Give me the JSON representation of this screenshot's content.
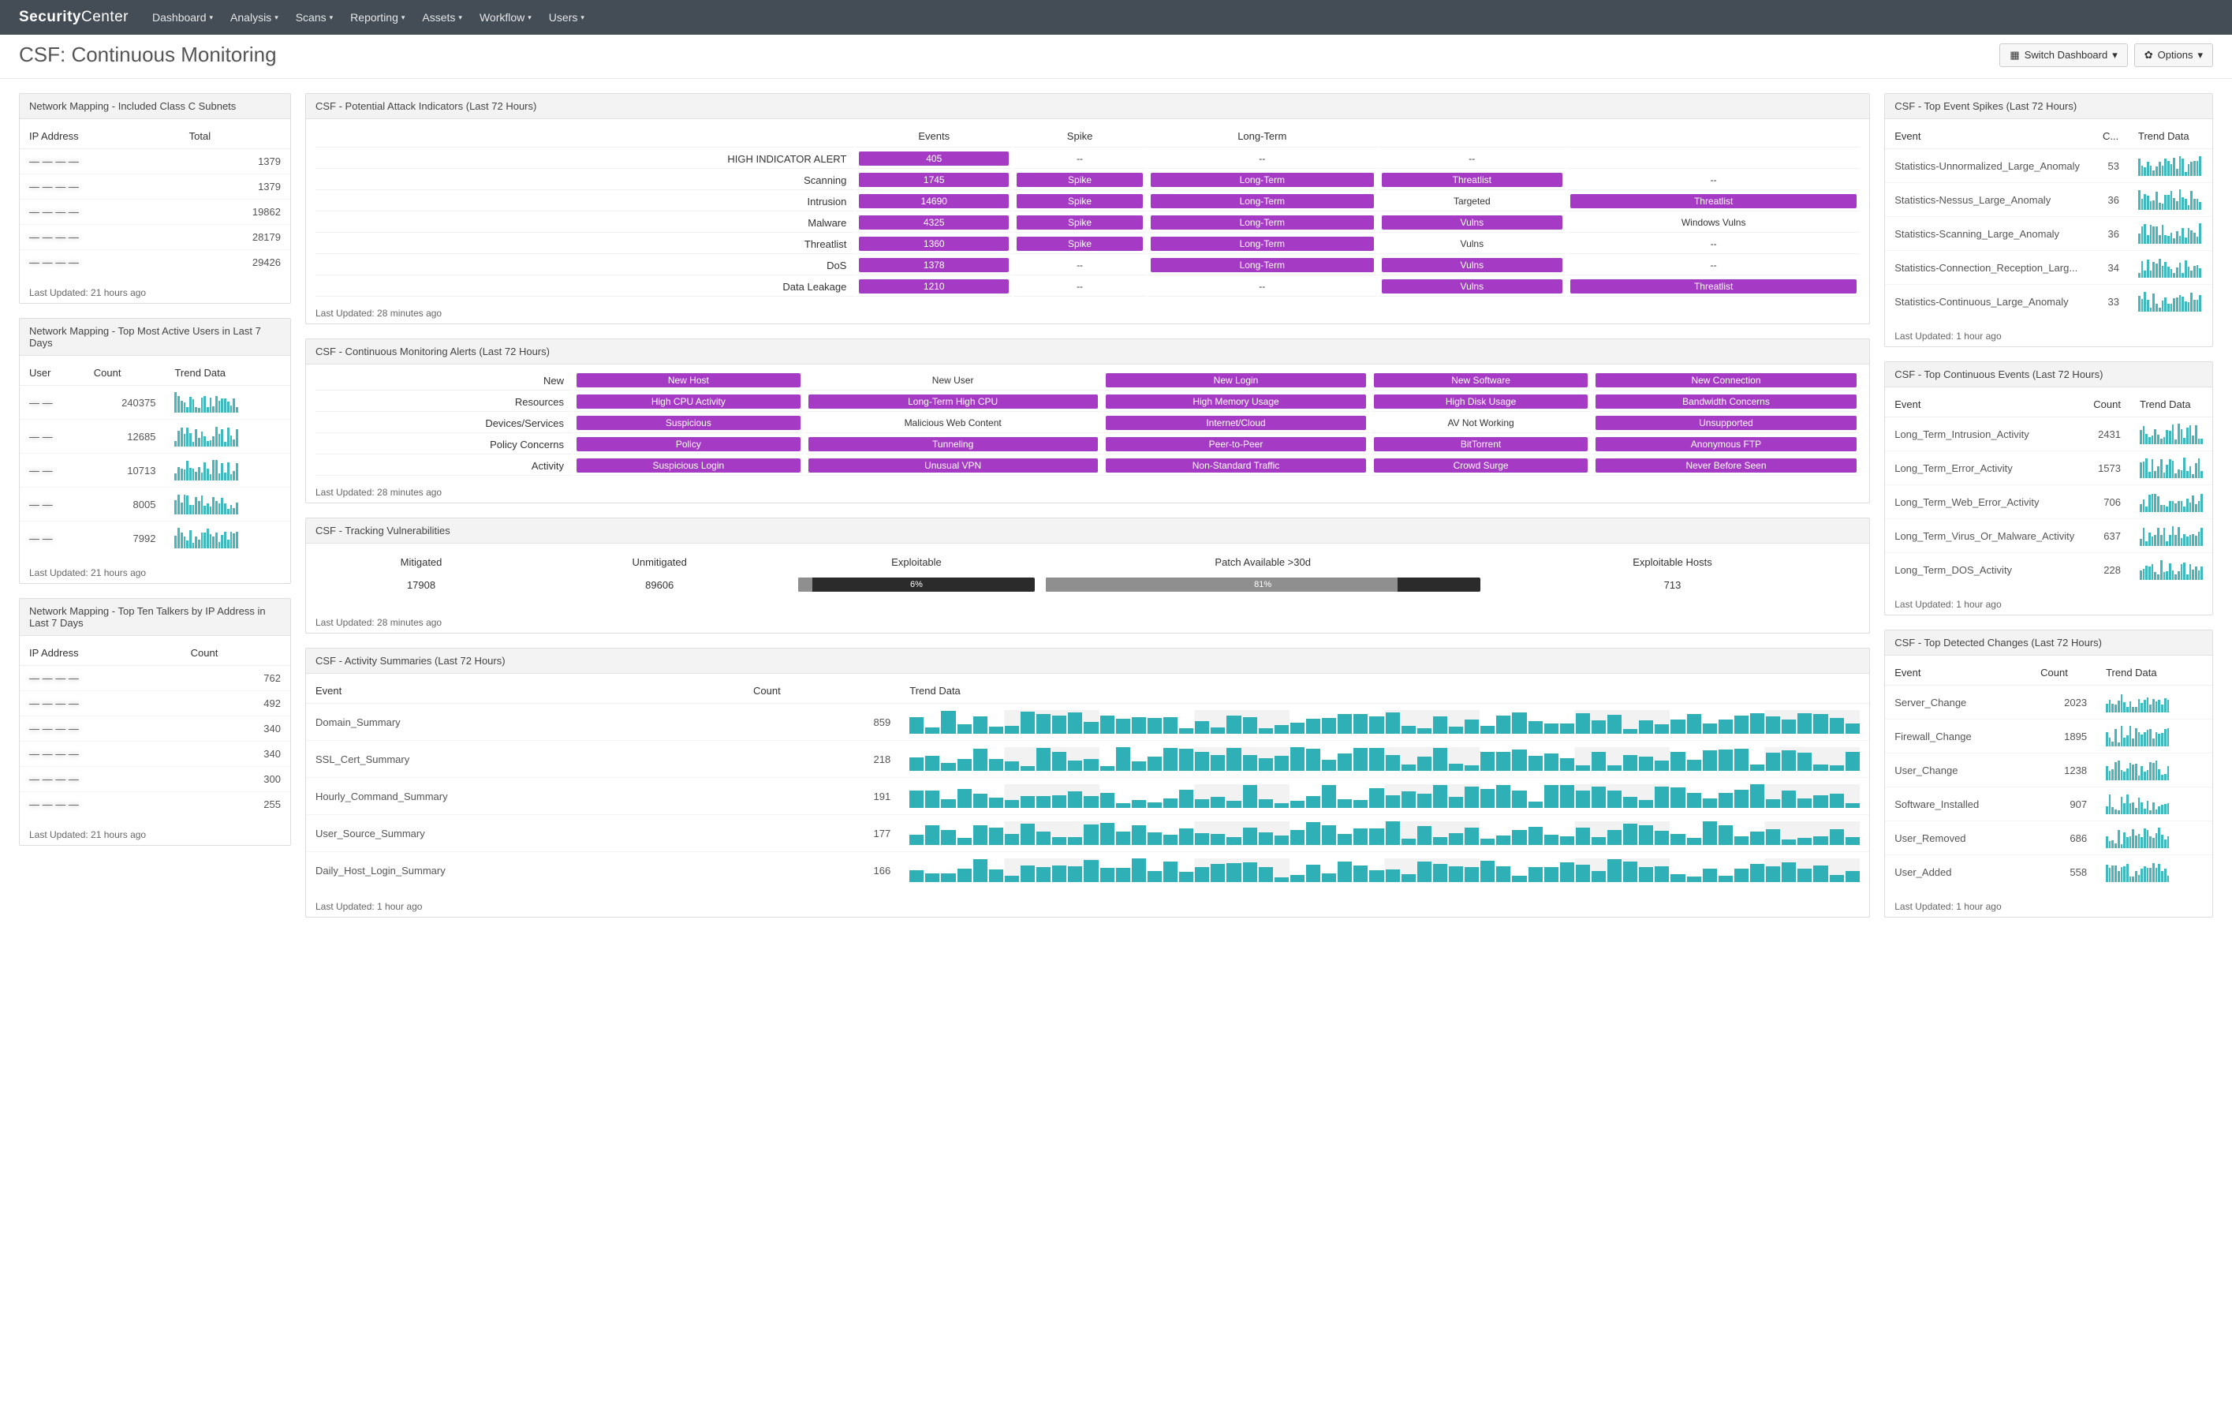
{
  "brand_bold": "Security",
  "brand_light": "Center",
  "nav": [
    "Dashboard",
    "Analysis",
    "Scans",
    "Reporting",
    "Assets",
    "Workflow",
    "Users"
  ],
  "page_title": "CSF: Continuous Monitoring",
  "switch_dash": "Switch Dashboard",
  "options": "Options",
  "nm_subnets": {
    "title": "Network Mapping - Included Class C Subnets",
    "cols": [
      "IP Address",
      "Total"
    ],
    "rows": [
      {
        "ip": "— — — —",
        "total": 1379
      },
      {
        "ip": "— — — —",
        "total": 1379
      },
      {
        "ip": "— — — —",
        "total": 19862
      },
      {
        "ip": "— — — —",
        "total": 28179
      },
      {
        "ip": "— — — —",
        "total": 29426
      }
    ],
    "updated": "Last Updated: 21 hours ago"
  },
  "nm_users": {
    "title": "Network Mapping - Top Most Active Users in Last 7 Days",
    "cols": [
      "User",
      "Count",
      "Trend Data"
    ],
    "rows": [
      {
        "user": "— —",
        "count": 240375
      },
      {
        "user": "— —",
        "count": 12685
      },
      {
        "user": "— —",
        "count": 10713
      },
      {
        "user": "— —",
        "count": 8005
      },
      {
        "user": "— —",
        "count": 7992
      }
    ],
    "updated": "Last Updated: 21 hours ago"
  },
  "nm_talkers": {
    "title": "Network Mapping - Top Ten Talkers by IP Address in Last 7 Days",
    "cols": [
      "IP Address",
      "Count"
    ],
    "rows": [
      {
        "ip": "— — — —",
        "count": 762
      },
      {
        "ip": "— — — —",
        "count": 492
      },
      {
        "ip": "— — — —",
        "count": 340
      },
      {
        "ip": "— — — —",
        "count": 340
      },
      {
        "ip": "— — — —",
        "count": 300
      },
      {
        "ip": "— — — —",
        "count": 255
      }
    ],
    "updated": "Last Updated: 21 hours ago"
  },
  "attack": {
    "title": "CSF - Potential Attack Indicators (Last 72 Hours)",
    "cols": [
      "",
      "Events",
      "Spike",
      "Long-Term",
      "",
      ""
    ],
    "rows": [
      {
        "name": "HIGH INDICATOR ALERT",
        "cells": [
          {
            "text": "405",
            "badge": true
          },
          {
            "text": "--"
          },
          {
            "text": "--"
          },
          {
            "text": "--"
          },
          {
            "text": ""
          }
        ]
      },
      {
        "name": "Scanning",
        "cells": [
          {
            "text": "1745",
            "badge": true
          },
          {
            "text": "Spike",
            "badge": true
          },
          {
            "text": "Long-Term",
            "badge": true
          },
          {
            "text": "Threatlist",
            "badge": true
          },
          {
            "text": "--"
          }
        ]
      },
      {
        "name": "Intrusion",
        "cells": [
          {
            "text": "14690",
            "badge": true
          },
          {
            "text": "Spike",
            "badge": true
          },
          {
            "text": "Long-Term",
            "badge": true
          },
          {
            "text": "Targeted"
          },
          {
            "text": "Threatlist",
            "badge": true
          }
        ]
      },
      {
        "name": "Malware",
        "cells": [
          {
            "text": "4325",
            "badge": true
          },
          {
            "text": "Spike",
            "badge": true
          },
          {
            "text": "Long-Term",
            "badge": true
          },
          {
            "text": "Vulns",
            "badge": true
          },
          {
            "text": "Windows Vulns"
          }
        ]
      },
      {
        "name": "Threatlist",
        "cells": [
          {
            "text": "1360",
            "badge": true
          },
          {
            "text": "Spike",
            "badge": true
          },
          {
            "text": "Long-Term",
            "badge": true
          },
          {
            "text": "Vulns"
          },
          {
            "text": "--"
          }
        ]
      },
      {
        "name": "DoS",
        "cells": [
          {
            "text": "1378",
            "badge": true
          },
          {
            "text": "--"
          },
          {
            "text": "Long-Term",
            "badge": true
          },
          {
            "text": "Vulns",
            "badge": true
          },
          {
            "text": "--"
          }
        ]
      },
      {
        "name": "Data Leakage",
        "cells": [
          {
            "text": "1210",
            "badge": true
          },
          {
            "text": "--"
          },
          {
            "text": "--"
          },
          {
            "text": "Vulns",
            "badge": true
          },
          {
            "text": "Threatlist",
            "badge": true
          }
        ]
      }
    ],
    "updated": "Last Updated: 28 minutes ago"
  },
  "alerts": {
    "title": "CSF - Continuous Monitoring Alerts (Last 72 Hours)",
    "rows": [
      {
        "name": "New",
        "cells": [
          {
            "text": "New Host",
            "badge": true
          },
          {
            "text": "New User"
          },
          {
            "text": "New Login",
            "badge": true
          },
          {
            "text": "New Software",
            "badge": true
          },
          {
            "text": "New Connection",
            "badge": true
          }
        ]
      },
      {
        "name": "Resources",
        "cells": [
          {
            "text": "High CPU Activity",
            "badge": true
          },
          {
            "text": "Long-Term High CPU",
            "badge": true
          },
          {
            "text": "High Memory Usage",
            "badge": true
          },
          {
            "text": "High Disk Usage",
            "badge": true
          },
          {
            "text": "Bandwidth Concerns",
            "badge": true
          }
        ]
      },
      {
        "name": "Devices/Services",
        "cells": [
          {
            "text": "Suspicious",
            "badge": true
          },
          {
            "text": "Malicious Web Content"
          },
          {
            "text": "Internet/Cloud",
            "badge": true
          },
          {
            "text": "AV Not Working"
          },
          {
            "text": "Unsupported",
            "badge": true
          }
        ]
      },
      {
        "name": "Policy Concerns",
        "cells": [
          {
            "text": "Policy",
            "badge": true
          },
          {
            "text": "Tunneling",
            "badge": true
          },
          {
            "text": "Peer-to-Peer",
            "badge": true
          },
          {
            "text": "BitTorrent",
            "badge": true
          },
          {
            "text": "Anonymous FTP",
            "badge": true
          }
        ]
      },
      {
        "name": "Activity",
        "cells": [
          {
            "text": "Suspicious Login",
            "badge": true
          },
          {
            "text": "Unusual VPN",
            "badge": true
          },
          {
            "text": "Non-Standard Traffic",
            "badge": true
          },
          {
            "text": "Crowd Surge",
            "badge": true
          },
          {
            "text": "Never Before Seen",
            "badge": true
          }
        ]
      }
    ],
    "updated": "Last Updated: 28 minutes ago"
  },
  "vulns": {
    "title": "CSF - Tracking Vulnerabilities",
    "cols": [
      "Mitigated",
      "Unmitigated",
      "Exploitable",
      "Patch Available >30d",
      "Exploitable Hosts"
    ],
    "mitigated": 17908,
    "unmitigated": 89606,
    "exploitable_pct": 6,
    "patch_pct": 81,
    "exploitable_hosts": 713,
    "updated": "Last Updated: 28 minutes ago"
  },
  "activity": {
    "title": "CSF - Activity Summaries (Last 72 Hours)",
    "cols": [
      "Event",
      "Count",
      "Trend Data"
    ],
    "rows": [
      {
        "event": "Domain_Summary",
        "count": 859
      },
      {
        "event": "SSL_Cert_Summary",
        "count": 218
      },
      {
        "event": "Hourly_Command_Summary",
        "count": 191
      },
      {
        "event": "User_Source_Summary",
        "count": 177
      },
      {
        "event": "Daily_Host_Login_Summary",
        "count": 166
      }
    ],
    "updated": "Last Updated: 1 hour ago"
  },
  "spikes": {
    "title": "CSF - Top Event Spikes (Last 72 Hours)",
    "cols": [
      "Event",
      "C...",
      "Trend Data"
    ],
    "rows": [
      {
        "event": "Statistics-Unnormalized_Large_Anomaly",
        "count": 53
      },
      {
        "event": "Statistics-Nessus_Large_Anomaly",
        "count": 36
      },
      {
        "event": "Statistics-Scanning_Large_Anomaly",
        "count": 36
      },
      {
        "event": "Statistics-Connection_Reception_Larg...",
        "count": 34
      },
      {
        "event": "Statistics-Continuous_Large_Anomaly",
        "count": 33
      }
    ],
    "updated": "Last Updated: 1 hour ago"
  },
  "continuous": {
    "title": "CSF - Top Continuous Events (Last 72 Hours)",
    "cols": [
      "Event",
      "Count",
      "Trend Data"
    ],
    "rows": [
      {
        "event": "Long_Term_Intrusion_Activity",
        "count": 2431
      },
      {
        "event": "Long_Term_Error_Activity",
        "count": 1573
      },
      {
        "event": "Long_Term_Web_Error_Activity",
        "count": 706
      },
      {
        "event": "Long_Term_Virus_Or_Malware_Activity",
        "count": 637
      },
      {
        "event": "Long_Term_DOS_Activity",
        "count": 228
      }
    ],
    "updated": "Last Updated: 1 hour ago"
  },
  "changes": {
    "title": "CSF - Top Detected Changes (Last 72 Hours)",
    "cols": [
      "Event",
      "Count",
      "Trend Data"
    ],
    "rows": [
      {
        "event": "Server_Change",
        "count": 2023
      },
      {
        "event": "Firewall_Change",
        "count": 1895
      },
      {
        "event": "User_Change",
        "count": 1238
      },
      {
        "event": "Software_Installed",
        "count": 907
      },
      {
        "event": "User_Removed",
        "count": 686
      },
      {
        "event": "User_Added",
        "count": 558
      }
    ],
    "updated": "Last Updated: 1 hour ago"
  }
}
